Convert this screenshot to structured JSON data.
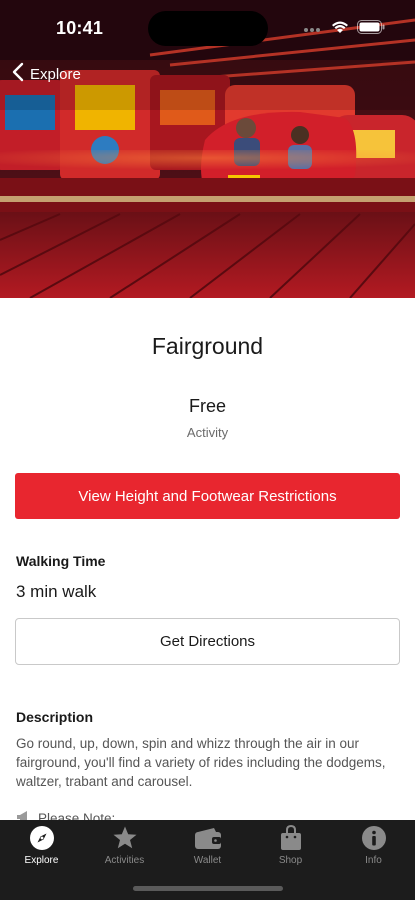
{
  "status": {
    "time": "10:41"
  },
  "nav": {
    "back_label": "Explore"
  },
  "hero": {
    "image_desc_icon": "fairground-ride-photo"
  },
  "attraction": {
    "title": "Fairground",
    "price": "Free",
    "type": "Activity"
  },
  "buttons": {
    "restrictions": "View Height and Footwear Restrictions",
    "directions": "Get Directions"
  },
  "walking": {
    "label": "Walking Time",
    "value": "3 min walk"
  },
  "description": {
    "label": "Description",
    "text": "Go round, up, down, spin and whizz through the air in our fairground, you'll find a variety of rides including the dodgems, waltzer, trabant and carousel.",
    "note": "Please Note:"
  },
  "tabs": [
    {
      "label": "Explore",
      "icon": "compass-icon",
      "active": true
    },
    {
      "label": "Activities",
      "icon": "star-icon",
      "active": false
    },
    {
      "label": "Wallet",
      "icon": "wallet-icon",
      "active": false
    },
    {
      "label": "Shop",
      "icon": "shopping-bag-icon",
      "active": false
    },
    {
      "label": "Info",
      "icon": "info-icon",
      "active": false
    }
  ],
  "colors": {
    "accent": "#e8262f",
    "tabbar": "#1c1c1c"
  }
}
